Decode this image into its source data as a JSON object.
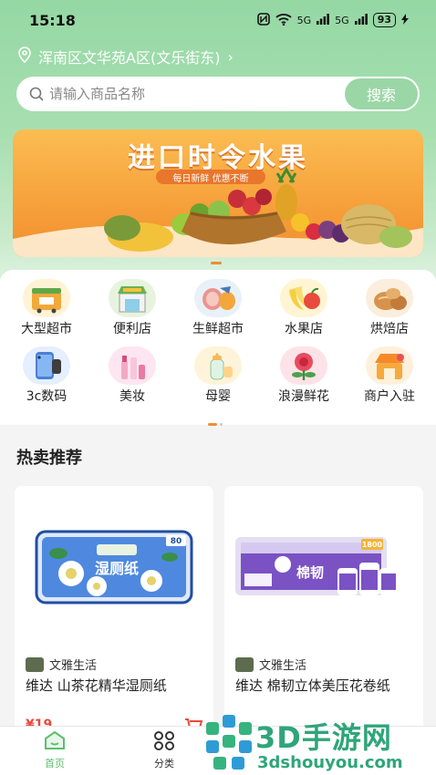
{
  "status_bar": {
    "time": "15:18",
    "signal_1": "5G",
    "signal_2": "5G",
    "battery": "93"
  },
  "location": {
    "address": "浑南区文华苑A区(文乐街东)",
    "chevron": "›"
  },
  "search": {
    "placeholder": "请输入商品名称",
    "button_label": "搜索"
  },
  "banner": {
    "title": "进口时令水果",
    "subtitle": "每日新鲜 优惠不断"
  },
  "categories": [
    {
      "label": "大型超市",
      "icon": "supermarket-icon"
    },
    {
      "label": "便利店",
      "icon": "convenience-store-icon"
    },
    {
      "label": "生鲜超市",
      "icon": "fresh-food-icon"
    },
    {
      "label": "水果店",
      "icon": "fruit-icon"
    },
    {
      "label": "烘焙店",
      "icon": "bakery-icon"
    },
    {
      "label": "3c数码",
      "icon": "phone-icon"
    },
    {
      "label": "美妆",
      "icon": "cosmetics-icon"
    },
    {
      "label": "母婴",
      "icon": "baby-bottle-icon"
    },
    {
      "label": "浪漫鲜花",
      "icon": "flower-icon"
    },
    {
      "label": "商户入驻",
      "icon": "merchant-join-icon"
    }
  ],
  "section": {
    "title": "热卖推荐"
  },
  "products": [
    {
      "shop": "文雅生活",
      "name": "维达 山茶花精华湿厕纸",
      "price": "¥19",
      "package_text": "湿厕纸",
      "package_count": "80"
    },
    {
      "shop": "文雅生活",
      "name": "维达 棉韧立体美压花卷纸",
      "package_text": "棉韧",
      "package_count": "1800"
    }
  ],
  "tabbar": {
    "home": "首页",
    "category": "分类"
  },
  "watermark": {
    "title": "3D手游网",
    "url": "3dshouyou.com"
  },
  "colors": {
    "brand_green": "#95d8a4",
    "button_green": "#9bd6a6",
    "price_red": "#e74a3c",
    "banner_orange": "#f7a23c"
  }
}
